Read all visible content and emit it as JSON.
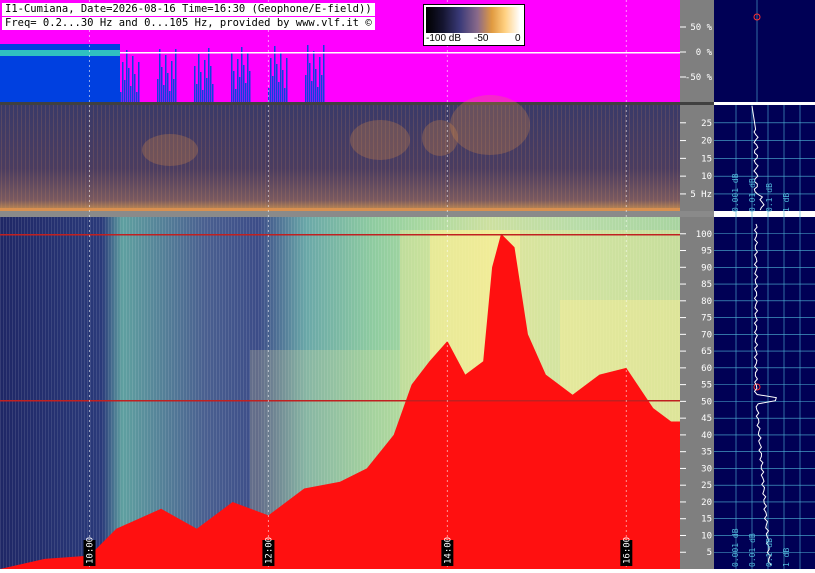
{
  "header": {
    "title_line": "I1-Cumiana, Date=2026-08-16 Time=16:30 (Geophone/E-field))",
    "freq_line": "Freq= 0.2...30 Hz and 0...105 Hz, provided by www.vlf.it ©"
  },
  "scale": {
    "min_label": "-100 dB",
    "mid_label": "-50",
    "max_label": "0"
  },
  "colors": {
    "waveform_bg": "#ff00ff",
    "saturation_red": "#ff1010",
    "right_panel_bg": "#000055",
    "grid_cyan": "#4fb6d8",
    "gray_axis": "#7f7f7f"
  },
  "chart_data": [
    {
      "type": "line",
      "name": "waveform",
      "y_unit": "%",
      "y_ticks": [
        "50 %",
        "0 %",
        "-50 %"
      ],
      "y_tick_values": [
        50,
        0,
        -50
      ]
    },
    {
      "type": "heatmap",
      "name": "low_frequency_spectrogram",
      "y_unit": "Hz",
      "y_ticks": [
        "25",
        "20",
        "15",
        "10",
        "5 Hz"
      ],
      "y_tick_values": [
        25,
        20,
        15,
        10,
        5
      ],
      "ylim": [
        0.2,
        30
      ]
    },
    {
      "type": "heatmap",
      "name": "high_frequency_spectrogram",
      "y_ticks": [
        "100",
        "95",
        "90",
        "85",
        "80",
        "75",
        "70",
        "65",
        "60",
        "55",
        "50",
        "45",
        "40",
        "35",
        "30",
        "25",
        "20",
        "15",
        "10",
        "5"
      ],
      "y_tick_values": [
        100,
        95,
        90,
        85,
        80,
        75,
        70,
        65,
        60,
        55,
        50,
        45,
        40,
        35,
        30,
        25,
        20,
        15,
        10,
        5
      ],
      "ylim": [
        0,
        105
      ],
      "time_labels": [
        "10:00",
        "12:00",
        "14:00",
        "16:00"
      ],
      "time_hours": [
        10,
        12,
        14,
        16
      ],
      "red_saturation_profile": [
        {
          "t": 9.0,
          "f": 0
        },
        {
          "t": 9.5,
          "f": 3
        },
        {
          "t": 10.0,
          "f": 4
        },
        {
          "t": 10.3,
          "f": 12
        },
        {
          "t": 10.8,
          "f": 18
        },
        {
          "t": 11.2,
          "f": 12
        },
        {
          "t": 11.6,
          "f": 20
        },
        {
          "t": 12.0,
          "f": 16
        },
        {
          "t": 12.4,
          "f": 24
        },
        {
          "t": 12.8,
          "f": 26
        },
        {
          "t": 13.1,
          "f": 30
        },
        {
          "t": 13.4,
          "f": 40
        },
        {
          "t": 13.6,
          "f": 55
        },
        {
          "t": 13.8,
          "f": 62
        },
        {
          "t": 14.0,
          "f": 68
        },
        {
          "t": 14.2,
          "f": 58
        },
        {
          "t": 14.4,
          "f": 62
        },
        {
          "t": 14.5,
          "f": 90
        },
        {
          "t": 14.6,
          "f": 100
        },
        {
          "t": 14.75,
          "f": 96
        },
        {
          "t": 14.9,
          "f": 70
        },
        {
          "t": 15.1,
          "f": 58
        },
        {
          "t": 15.4,
          "f": 52
        },
        {
          "t": 15.7,
          "f": 58
        },
        {
          "t": 16.0,
          "f": 60
        },
        {
          "t": 16.3,
          "f": 48
        },
        {
          "t": 16.5,
          "f": 44
        }
      ]
    },
    {
      "type": "line",
      "name": "right_spectrum_profiles",
      "x_ticks": [
        "0.001 dB",
        "0.01 dB",
        "0.1 dB",
        "1 dB"
      ],
      "legend_position": "none"
    }
  ]
}
